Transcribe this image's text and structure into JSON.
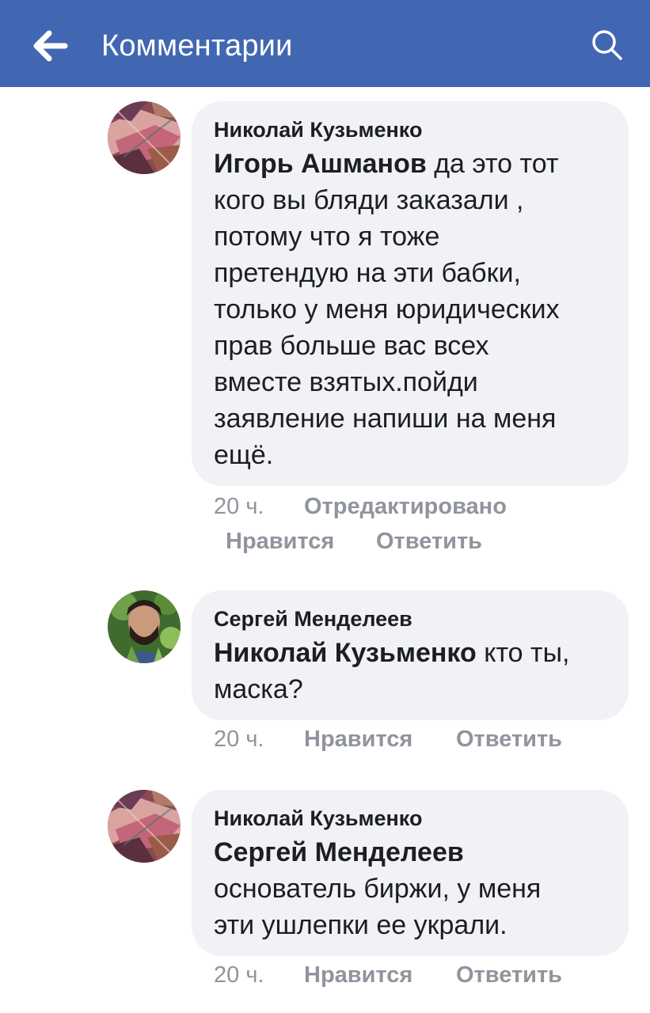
{
  "header": {
    "title": "Комментарии",
    "back_icon": "arrow-left-icon",
    "search_icon": "search-icon",
    "background": "#4267b2"
  },
  "comments": [
    {
      "author": "Николай Кузьменко",
      "mention": "Игорь Ашманов",
      "lines": [
        " да это тот",
        "кого вы бляди заказали ,",
        "потому что я тоже",
        "претендую на эти бабки,",
        "только у меня юридических",
        "прав больше вас всех",
        "вместе взятых.пойди",
        "заявление напиши на меня",
        "ещё."
      ],
      "time": "20 ч.",
      "edited": "Отредактировано",
      "like": "Нравится",
      "reply": "Ответить"
    },
    {
      "author": "Сергей Менделеев",
      "mention": "Николай Кузьменко",
      "lines": [
        " кто ты,",
        "маска?"
      ],
      "time": "20 ч.",
      "like": "Нравится",
      "reply": "Ответить"
    },
    {
      "author": "Николай Кузьменко",
      "mention": "Сергей Менделеев",
      "lines": [
        "основатель биржи, у меня",
        "эти ушлепки ее украли."
      ],
      "time": "20 ч.",
      "like": "Нравится",
      "reply": "Ответить"
    }
  ]
}
